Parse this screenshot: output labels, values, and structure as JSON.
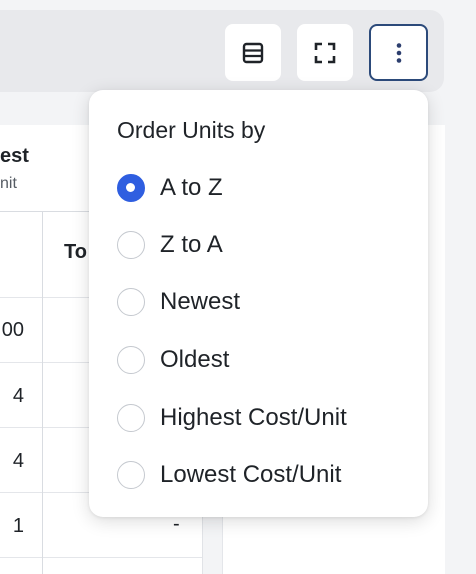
{
  "toolbar": {
    "list_icon": "table-rows-icon",
    "expand_icon": "fullscreen-icon",
    "more_icon": "more-vertical-icon"
  },
  "table": {
    "header_title": "est",
    "header_subtitle": "nit",
    "column_header": "To",
    "rows": [
      {
        "left": "00",
        "right": ""
      },
      {
        "left": "4",
        "right": ""
      },
      {
        "left": "4",
        "right": ""
      },
      {
        "left": "1",
        "right": "-"
      }
    ]
  },
  "menu": {
    "title": "Order Units by",
    "options": [
      {
        "label": "A to Z",
        "selected": true
      },
      {
        "label": "Z to A",
        "selected": false
      },
      {
        "label": "Newest",
        "selected": false
      },
      {
        "label": "Oldest",
        "selected": false
      },
      {
        "label": "Highest Cost/Unit",
        "selected": false
      },
      {
        "label": "Lowest Cost/Unit",
        "selected": false
      }
    ]
  },
  "colors": {
    "accent": "#2f5ee0",
    "focus_border": "#2c4a7a",
    "text": "#1f2328"
  }
}
